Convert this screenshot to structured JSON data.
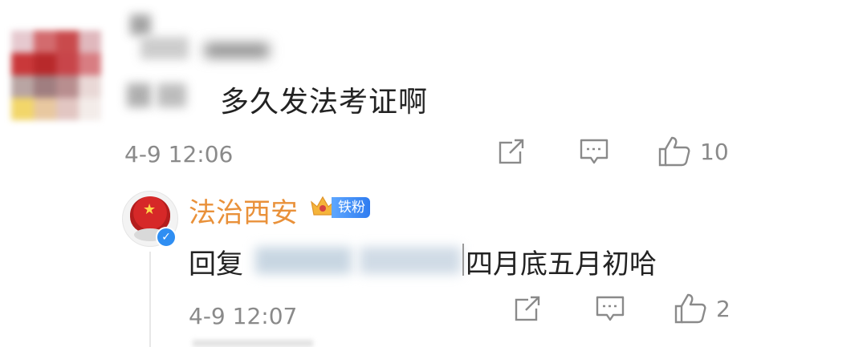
{
  "comment": {
    "text": "多久发法考证啊",
    "time": "4-9 12:06",
    "like_count": "10",
    "icons": [
      "share-icon",
      "comment-icon",
      "like-icon"
    ]
  },
  "reply": {
    "author": "法治西安",
    "badge": "铁粉",
    "prefix": "回复",
    "text": "四月底五月初哈",
    "time": "4-9 12:07",
    "like_count": "2",
    "icons": [
      "share-icon",
      "comment-icon",
      "like-icon",
      "verified-icon",
      "crown-icon"
    ]
  },
  "colors": {
    "author_name": "#e9913a",
    "meta_gray": "#8a8a8a",
    "badge_blue": "#2f7cf0",
    "verified_blue": "#2f8ef2"
  }
}
